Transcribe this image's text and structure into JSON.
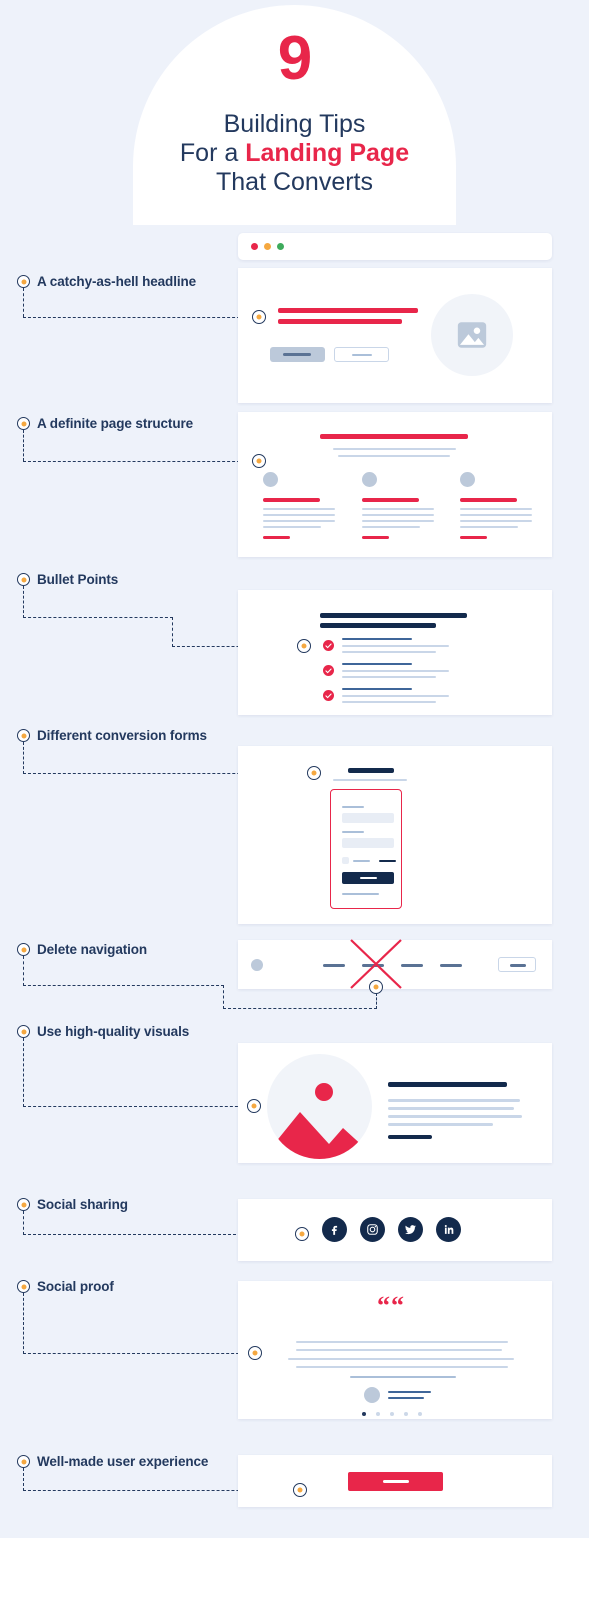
{
  "header": {
    "number": "9",
    "line1": "Building Tips",
    "line2_pre": "For a ",
    "line2_red": "Landing Page",
    "line3": "That Converts"
  },
  "browser": {
    "dots": [
      "close-red",
      "minimize-orange",
      "maximize-green"
    ]
  },
  "colors": {
    "background": "#eef2fa",
    "card": "#ffffff",
    "accent_red": "#e8264a",
    "navy": "#132a4c",
    "label_navy": "#23395e",
    "pin_orange": "#f5a840",
    "line_light": "#c9d6e8",
    "traffic_red": "#e8264a",
    "traffic_orange": "#f5a840",
    "traffic_green": "#3eab5c"
  },
  "tips": [
    {
      "index": 1,
      "label": "A catchy-as-hell headline",
      "mock": "hero-headline"
    },
    {
      "index": 2,
      "label": "A definite page structure",
      "mock": "three-column-structure"
    },
    {
      "index": 3,
      "label": "Bullet Points",
      "mock": "checklist"
    },
    {
      "index": 4,
      "label": "Different conversion forms",
      "mock": "form"
    },
    {
      "index": 5,
      "label": "Delete navigation",
      "mock": "navbar-crossed-out"
    },
    {
      "index": 6,
      "label": "Use high-quality visuals",
      "mock": "image-with-text"
    },
    {
      "index": 7,
      "label": "Social sharing",
      "mock": "social-icons"
    },
    {
      "index": 8,
      "label": "Social proof",
      "mock": "testimonial"
    },
    {
      "index": 9,
      "label": "Well-made user experience",
      "mock": "cta-button"
    }
  ],
  "social_icons": [
    "facebook-icon",
    "instagram-icon",
    "twitter-icon",
    "linkedin-icon"
  ],
  "testimonial": {
    "quote_glyph": "“",
    "pagination_dots": 5,
    "active_dot": 1
  }
}
